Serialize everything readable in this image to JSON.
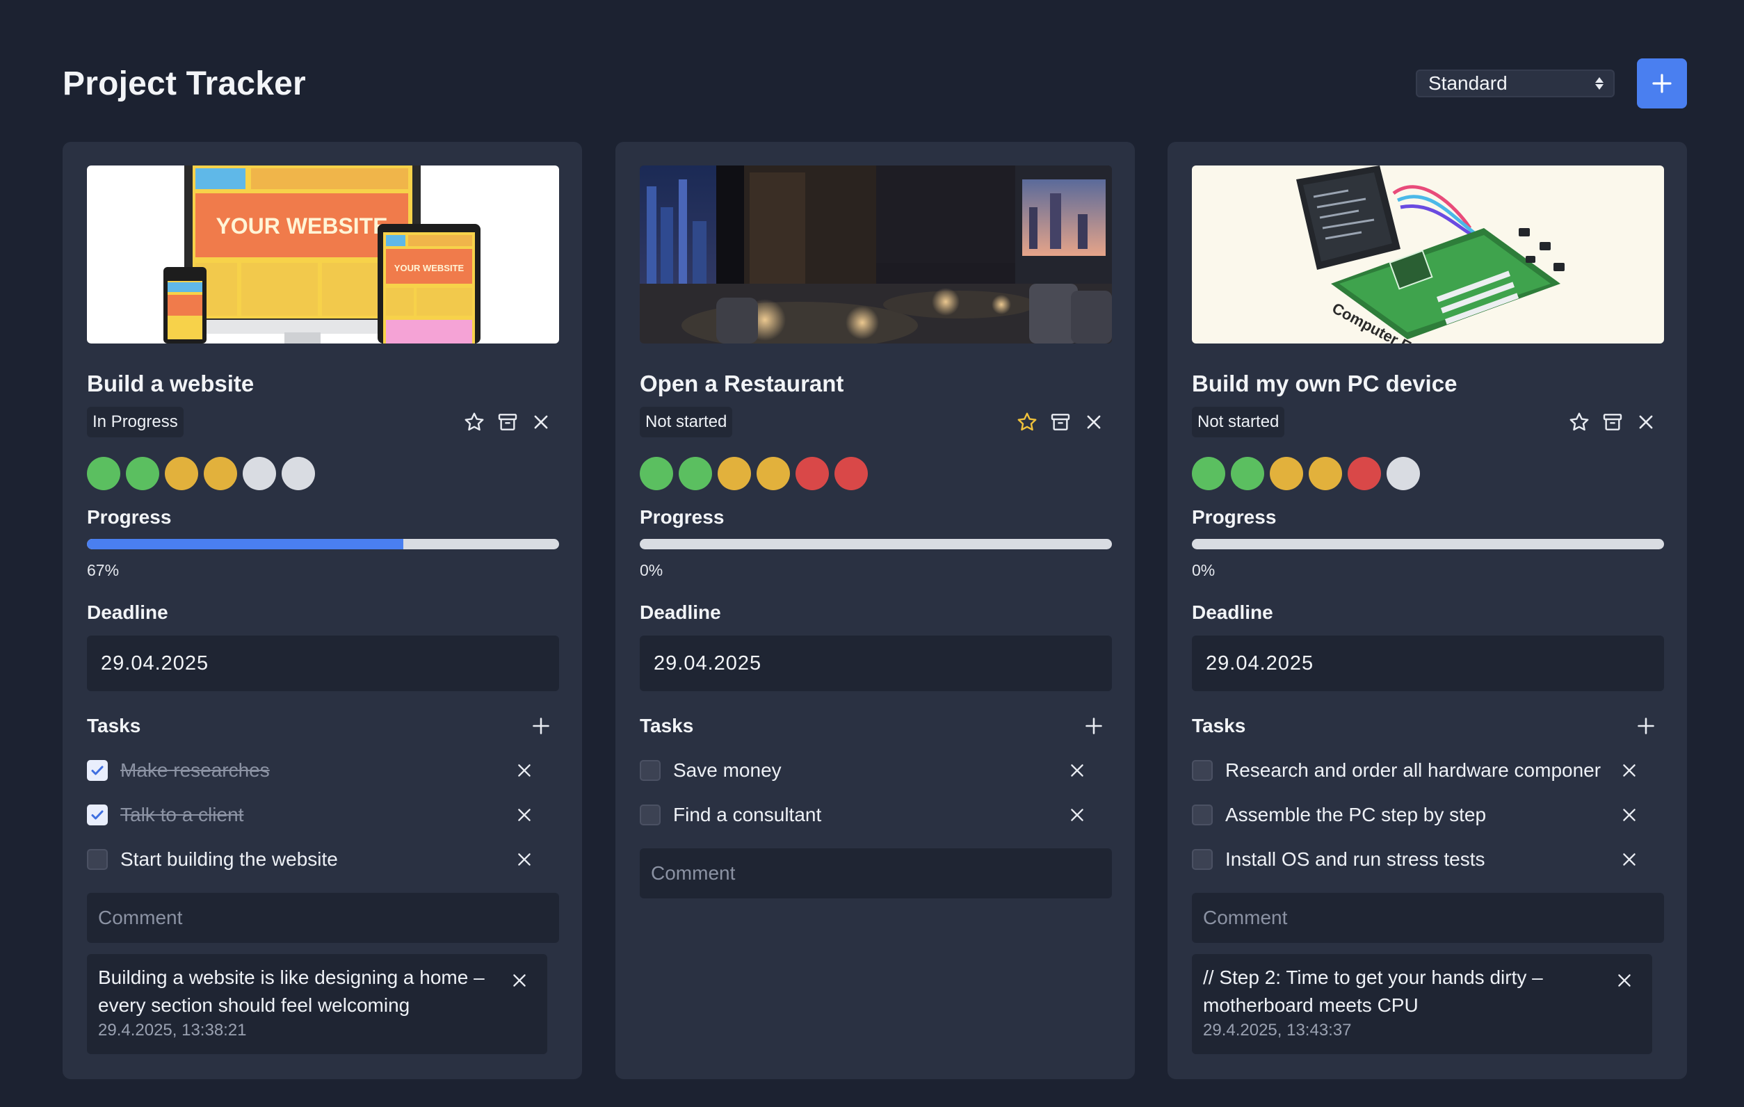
{
  "app": {
    "title": "Project Tracker"
  },
  "toolbar": {
    "view_select": "Standard",
    "add_icon": "plus-icon"
  },
  "labels": {
    "progress": "Progress",
    "deadline": "Deadline",
    "tasks": "Tasks",
    "comment_placeholder": "Comment"
  },
  "colors": {
    "background": "#1c2231",
    "card": "#2a3142",
    "accent": "#4a7ff0",
    "green": "#5bbf60",
    "yellow": "#e2b13c",
    "red": "#d94848",
    "grey": "#d9dce2",
    "star_active": "#f0c23b"
  },
  "projects": [
    {
      "title": "Build a website",
      "status": "In Progress",
      "image": "website-mockup-image",
      "favorite": false,
      "dots": [
        "green",
        "green",
        "yellow",
        "yellow",
        "grey",
        "grey"
      ],
      "progress": 0.67,
      "progress_text": "67%",
      "deadline": "29.04.2025",
      "tasks": [
        {
          "text": "Make researches",
          "done": true
        },
        {
          "text": "Talk to a client",
          "done": true
        },
        {
          "text": "Start building the website",
          "done": false
        }
      ],
      "comments": [
        {
          "text": "Building a website is like designing a home – every section should feel welcoming",
          "time": "29.4.2025, 13:38:21"
        }
      ]
    },
    {
      "title": "Open a Restaurant",
      "status": "Not started",
      "image": "restaurant-interior-image",
      "favorite": true,
      "dots": [
        "green",
        "green",
        "yellow",
        "yellow",
        "red",
        "red"
      ],
      "progress": 0,
      "progress_text": "0%",
      "deadline": "29.04.2025",
      "tasks": [
        {
          "text": "Save money",
          "done": false
        },
        {
          "text": "Find a consultant",
          "done": false
        }
      ],
      "comments": []
    },
    {
      "title": "Build my own PC device",
      "status": "Not started",
      "image": "computer-engineering-image",
      "favorite": false,
      "dots": [
        "green",
        "green",
        "yellow",
        "yellow",
        "red",
        "grey"
      ],
      "progress": 0,
      "progress_text": "0%",
      "deadline": "29.04.2025",
      "tasks": [
        {
          "text": "Research and order all hardware componer",
          "done": false
        },
        {
          "text": "Assemble the PC step by step",
          "done": false
        },
        {
          "text": "Install OS and run stress tests",
          "done": false
        }
      ],
      "comments": [
        {
          "text": "// Step 2: Time to get your hands dirty – motherboard meets CPU",
          "time": "29.4.2025, 13:43:37"
        }
      ]
    }
  ],
  "image_text": {
    "website_big": "YOUR WEBSITE",
    "website_small": "YOUR WEBSITE",
    "pc_caption": "Computer Engineering"
  }
}
